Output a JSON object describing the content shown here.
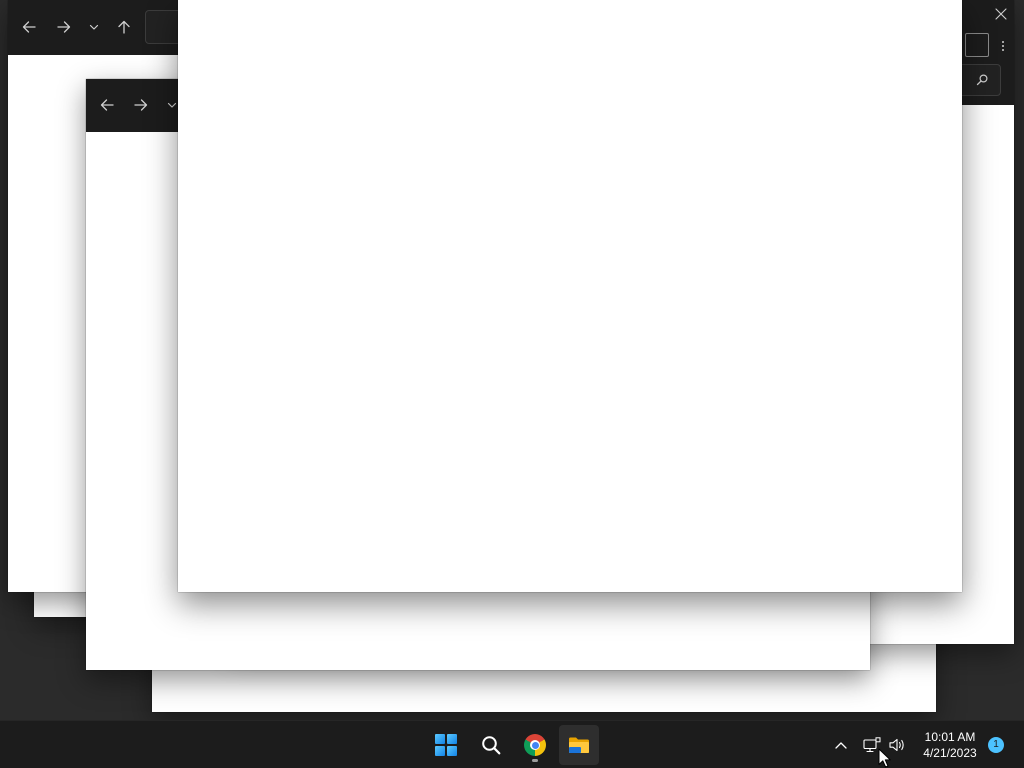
{
  "desktop": {
    "background_color": "#2b2b2b"
  },
  "explorer_windows": {
    "header_color": "#1c1c1c",
    "body_color": "#ffffff",
    "nav_icons": [
      "back-arrow-icon",
      "forward-arrow-icon",
      "chevron-down-icon",
      "up-arrow-icon"
    ],
    "toolbar_icons": [
      "close-icon",
      "view-icon",
      "more-icon",
      "search-icon"
    ]
  },
  "taskbar": {
    "background_color": "#1c1c1c",
    "apps": [
      {
        "icon": "windows-start-icon"
      },
      {
        "icon": "search-icon"
      },
      {
        "icon": "chrome-icon",
        "running": true
      },
      {
        "icon": "file-explorer-icon",
        "active": true
      }
    ],
    "tray": {
      "icons": [
        "chevron-up-icon",
        "network-icon",
        "volume-icon"
      ],
      "time": "10:01 AM",
      "date": "4/21/2023",
      "notification_count": "1",
      "badge_color": "#4cc2ff"
    }
  }
}
